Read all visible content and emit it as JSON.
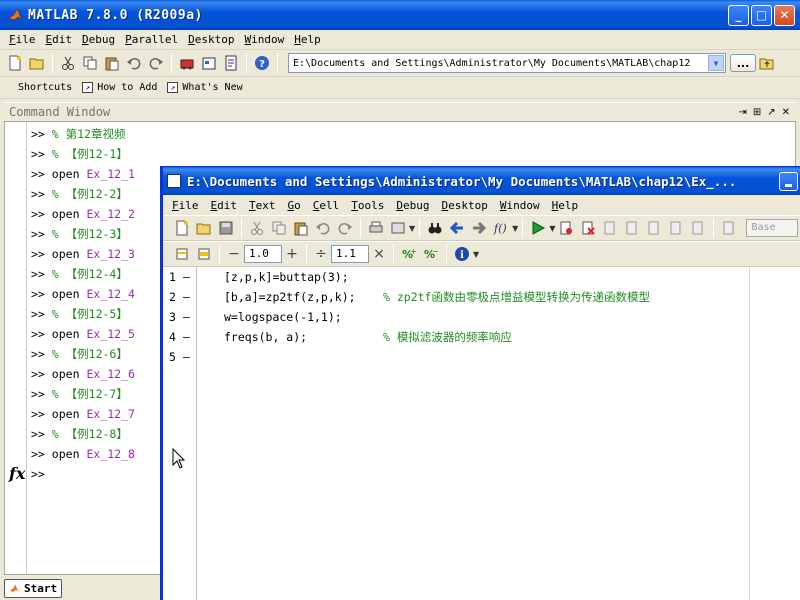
{
  "main": {
    "title": "MATLAB  7.8.0 (R2009a)",
    "menu": [
      "File",
      "Edit",
      "Debug",
      "Parallel",
      "Desktop",
      "Window",
      "Help"
    ],
    "current_folder": "E:\\Documents and Settings\\Administrator\\My Documents\\MATLAB\\chap12",
    "browse_label": "...",
    "shortcuts": {
      "label": "Shortcuts",
      "items": [
        "How to Add",
        "What's New"
      ]
    },
    "command_window_title": "Command Window",
    "status_start": "Start"
  },
  "command_window": {
    "lines": [
      {
        "prompt": ">>",
        "text": "% 第12章视频",
        "kind": "comment"
      },
      {
        "prompt": ">>",
        "text": "% 【例12-1】",
        "kind": "comment"
      },
      {
        "prompt": ">>",
        "cmd": "open",
        "text": "Ex_12_1",
        "kind": "open"
      },
      {
        "prompt": ">>",
        "text": "% 【例12-2】",
        "kind": "comment"
      },
      {
        "prompt": ">>",
        "cmd": "open",
        "text": "Ex_12_2",
        "kind": "open"
      },
      {
        "prompt": ">>",
        "text": "% 【例12-3】",
        "kind": "comment"
      },
      {
        "prompt": ">>",
        "cmd": "open",
        "text": "Ex_12_3",
        "kind": "open"
      },
      {
        "prompt": ">>",
        "text": "% 【例12-4】",
        "kind": "comment"
      },
      {
        "prompt": ">>",
        "cmd": "open",
        "text": "Ex_12_4",
        "kind": "open"
      },
      {
        "prompt": ">>",
        "text": "% 【例12-5】",
        "kind": "comment"
      },
      {
        "prompt": ">>",
        "cmd": "open",
        "text": "Ex_12_5",
        "kind": "open"
      },
      {
        "prompt": ">>",
        "text": "% 【例12-6】",
        "kind": "comment"
      },
      {
        "prompt": ">>",
        "cmd": "open",
        "text": "Ex_12_6",
        "kind": "open"
      },
      {
        "prompt": ">>",
        "text": "% 【例12-7】",
        "kind": "comment"
      },
      {
        "prompt": ">>",
        "cmd": "open",
        "text": "Ex_12_7",
        "kind": "open"
      },
      {
        "prompt": ">>",
        "text": "% 【例12-8】",
        "kind": "comment"
      },
      {
        "prompt": ">>",
        "cmd": "open",
        "text": "Ex_12_8",
        "kind": "open"
      },
      {
        "prompt": ">>",
        "text": "",
        "kind": "blank"
      }
    ],
    "fx_label": "fx"
  },
  "editor": {
    "title": "E:\\Documents and Settings\\Administrator\\My Documents\\MATLAB\\chap12\\Ex_...",
    "menu": [
      "File",
      "Edit",
      "Text",
      "Go",
      "Cell",
      "Tools",
      "Debug",
      "Desktop",
      "Window",
      "Help"
    ],
    "cell_step": "1.0",
    "cell_scale": "1.1",
    "base_label": "Base",
    "lines": [
      {
        "num": "1",
        "code": "[z,p,k]=buttap(3);",
        "comment": ""
      },
      {
        "num": "2",
        "code": "[b,a]=zp2tf(z,p,k);",
        "comment": "%  zp2tf函数由零极点增益模型转换为传递函数模型"
      },
      {
        "num": "3",
        "code": "w=logspace(-1,1);",
        "comment": ""
      },
      {
        "num": "4",
        "code": "freqs(b, a);",
        "comment": "%  模拟滤波器的频率响应"
      },
      {
        "num": "5",
        "code": "",
        "comment": ""
      }
    ]
  },
  "colors": {
    "titlebar": "#0454d9",
    "comment": "#228b22",
    "link": "#9b2fae"
  }
}
